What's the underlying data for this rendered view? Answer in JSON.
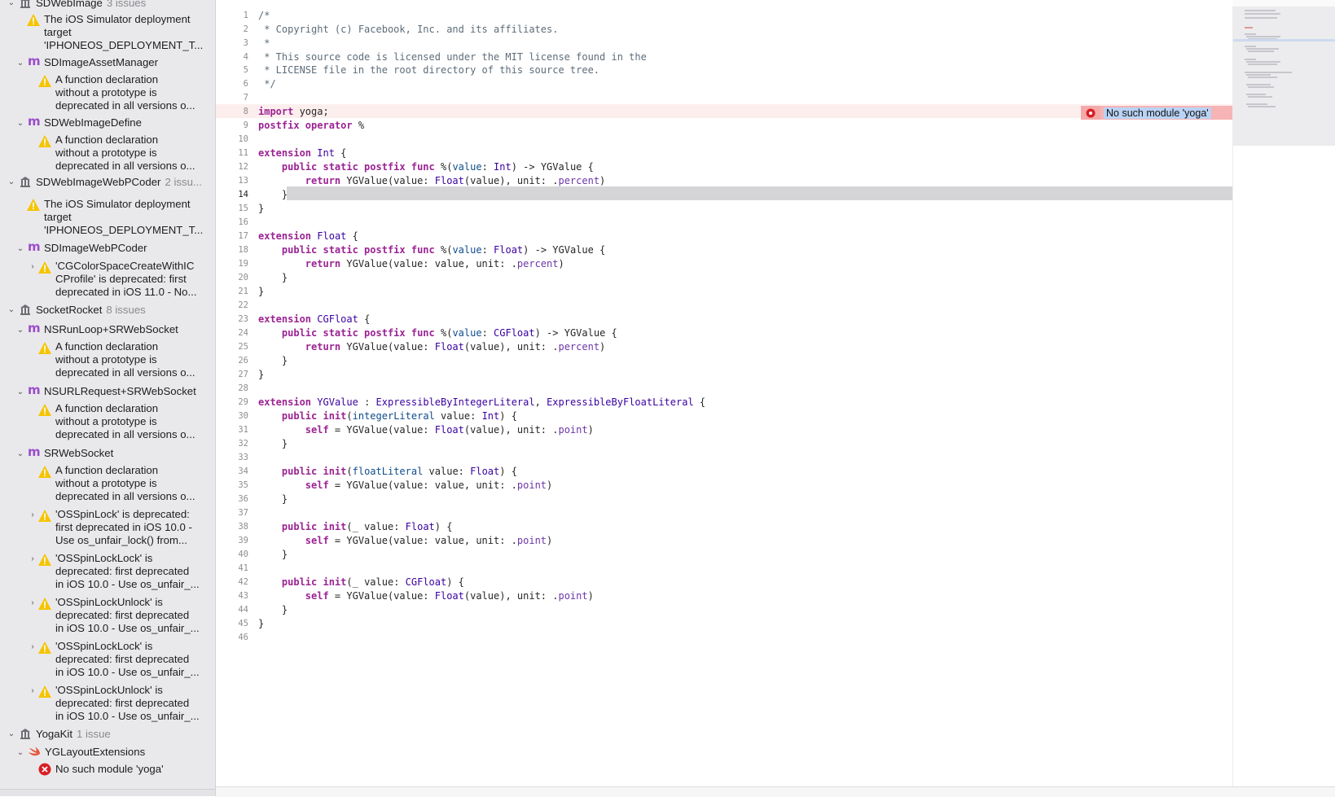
{
  "sidebar": {
    "groups": [
      {
        "name": "SDWebImage",
        "count": "3 issues"
      },
      {
        "name": "SDWebImageWebPCoder",
        "count": "2 issu..."
      },
      {
        "name": "SocketRocket",
        "count": "8 issues"
      },
      {
        "name": "YogaKit",
        "count": "1 issue"
      }
    ],
    "files": [
      "SDImageAssetManager",
      "SDWebImageDefine",
      "SDImageWebPCoder",
      "NSRunLoop+SRWebSocket",
      "NSURLRequest+SRWebSocket",
      "SRWebSocket",
      "YGLayoutExtensions"
    ],
    "issues": {
      "sim_target": [
        "The iOS Simulator deployment",
        "target",
        "'IPHONEOS_DEPLOYMENT_T..."
      ],
      "func_decl": [
        "A function declaration",
        "without a prototype is",
        "deprecated in all versions o..."
      ],
      "cg_color": [
        "'CGColorSpaceCreateWithIC",
        "CProfile' is deprecated: first",
        "deprecated in iOS 11.0 - No..."
      ],
      "osspin_lock": [
        "'OSSpinLock' is deprecated:",
        "first deprecated in iOS 10.0 -",
        "Use os_unfair_lock() from..."
      ],
      "osspin_locklock": [
        "'OSSpinLockLock' is",
        "deprecated: first deprecated",
        "in iOS 10.0 - Use os_unfair_..."
      ],
      "osspin_lockunlock": [
        "'OSSpinLockUnlock' is",
        "deprecated: first deprecated",
        "in iOS 10.0 - Use os_unfair_..."
      ],
      "yoga_error": "No such module 'yoga'"
    }
  },
  "editor": {
    "line_numbers": [
      "1",
      "2",
      "3",
      "4",
      "5",
      "6",
      "7",
      "8",
      "9",
      "10",
      "11",
      "12",
      "13",
      "14",
      "15",
      "16",
      "17",
      "18",
      "19",
      "20",
      "21",
      "22",
      "23",
      "24",
      "25",
      "26",
      "27",
      "28",
      "29",
      "30",
      "31",
      "32",
      "33",
      "34",
      "35",
      "36",
      "37",
      "38",
      "39",
      "40",
      "41",
      "42",
      "43",
      "44",
      "45",
      "46"
    ],
    "current_line": 14,
    "error_line": 8,
    "error_message": "No such module 'yoga'"
  },
  "colors": {
    "keyword": "#9b2393",
    "type": "#3900a0",
    "comment": "#5d6c79",
    "error_bg": "#f6b4b4",
    "warning": "#f5c400",
    "error": "#d71f25"
  }
}
